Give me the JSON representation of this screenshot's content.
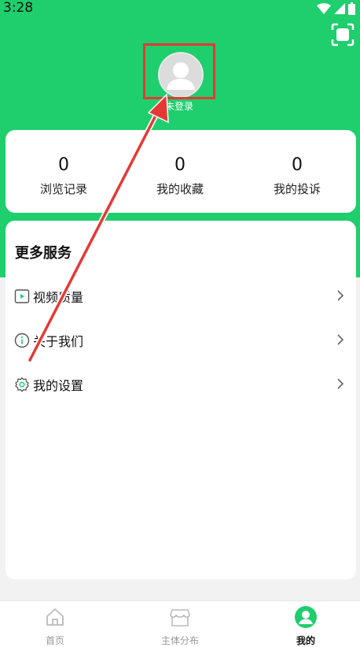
{
  "status_bar": {
    "time": "3:28"
  },
  "profile": {
    "login_text": "未登录"
  },
  "stats": [
    {
      "value": "0",
      "label": "浏览记录"
    },
    {
      "value": "0",
      "label": "我的收藏"
    },
    {
      "value": "0",
      "label": "我的投诉"
    }
  ],
  "services": {
    "title": "更多服务",
    "items": [
      {
        "label": "视频质量",
        "icon": "video-icon"
      },
      {
        "label": "关于我们",
        "icon": "info-icon"
      },
      {
        "label": "我的设置",
        "icon": "gear-icon"
      }
    ]
  },
  "tabbar": {
    "tabs": [
      {
        "label": "首页",
        "icon": "home-icon"
      },
      {
        "label": "主体分布",
        "icon": "store-icon"
      },
      {
        "label": "我的",
        "icon": "user-icon"
      }
    ]
  },
  "colors": {
    "brand": "#1fce6d",
    "annotation": "#e53935"
  }
}
